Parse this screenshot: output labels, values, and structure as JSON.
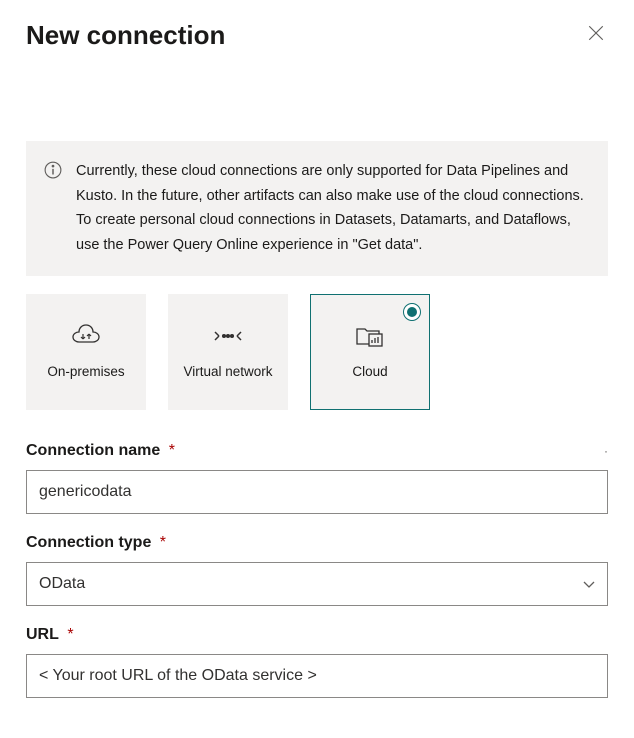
{
  "header": {
    "title": "New connection"
  },
  "info": {
    "text": "Currently, these cloud connections are only supported for Data Pipelines and Kusto. In the future, other artifacts can also make use of the cloud connections. To create personal cloud connections in Datasets, Datamarts, and Dataflows, use the Power Query Online experience in \"Get data\"."
  },
  "connection_types": [
    {
      "id": "onprem",
      "label": "On-premises",
      "selected": false
    },
    {
      "id": "vnet",
      "label": "Virtual network",
      "selected": false
    },
    {
      "id": "cloud",
      "label": "Cloud",
      "selected": true
    }
  ],
  "fields": {
    "connection_name": {
      "label": "Connection name",
      "required": true,
      "value": "genericodata"
    },
    "connection_type": {
      "label": "Connection type",
      "required": true,
      "value": "OData"
    },
    "url": {
      "label": "URL",
      "required": true,
      "value": "< Your root URL of the OData service >"
    }
  },
  "required_marker": "*"
}
